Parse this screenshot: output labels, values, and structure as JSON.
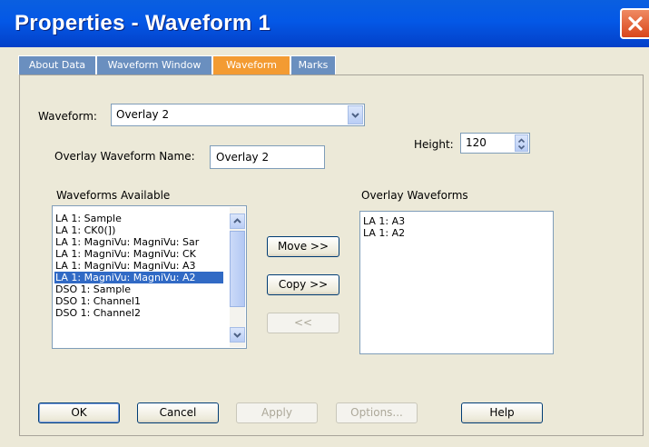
{
  "window": {
    "title": "Properties - Waveform 1"
  },
  "tabs": [
    {
      "label": "About Data",
      "active": false
    },
    {
      "label": "Waveform Window",
      "active": false
    },
    {
      "label": "Waveform",
      "active": true
    },
    {
      "label": "Marks",
      "active": false
    }
  ],
  "waveform": {
    "label": "Waveform:",
    "value": "Overlay 2"
  },
  "overlay_name": {
    "label": "Overlay Waveform Name:",
    "value": "Overlay 2"
  },
  "height": {
    "label": "Height:",
    "value": "120"
  },
  "available": {
    "label": "Waveforms Available",
    "items": [
      "LA 1: Sample",
      "LA 1: CK0(])",
      "LA 1: MagniVu: MagniVu: Sar",
      "LA 1: MagniVu: MagniVu: CK",
      "LA 1: MagniVu: MagniVu: A3",
      "LA 1: MagniVu: MagniVu: A2",
      "DSO 1: Sample",
      "DSO 1: Channel1",
      "DSO 1: Channel2"
    ],
    "selected_index": 5
  },
  "overlay_waveforms": {
    "label": "Overlay Waveforms",
    "items": [
      "LA 1: A3",
      "LA 1: A2"
    ]
  },
  "move_buttons": {
    "move": "Move >>",
    "copy": "Copy >>",
    "remove": "<<"
  },
  "footer": {
    "ok": "OK",
    "cancel": "Cancel",
    "apply": "Apply",
    "options": "Options...",
    "help": "Help"
  },
  "colors": {
    "titlebar": "#0458e6",
    "active_tab": "#f39b32",
    "selection": "#316ac5",
    "close": "#d9461b"
  }
}
